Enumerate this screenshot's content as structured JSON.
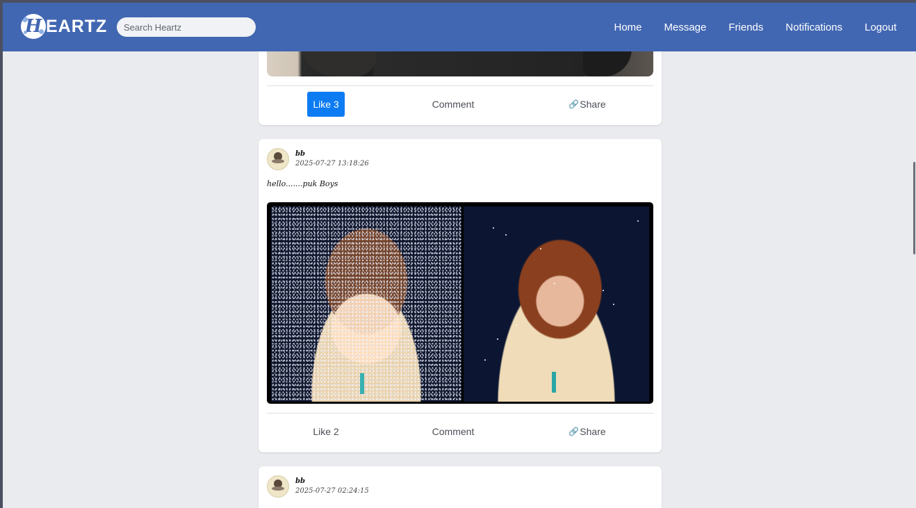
{
  "navbar": {
    "logo_letter": "H",
    "logo_text": "EARTZ",
    "search_placeholder": "Search Heartz",
    "links": [
      "Home",
      "Message",
      "Friends",
      "Notifications",
      "Logout"
    ]
  },
  "colors": {
    "navbar": "#4267b2",
    "background": "#e9ebee",
    "like_active": "#0d7cf2"
  },
  "posts": [
    {
      "actions": {
        "like": "Like 3",
        "like_active": true,
        "comment": "Comment",
        "share": "Share"
      }
    },
    {
      "author": "bb",
      "timestamp": "2025-07-27 13:18:26",
      "text": "hello.......puk Boys",
      "actions": {
        "like": "Like 2",
        "like_active": false,
        "comment": "Comment",
        "share": "Share"
      }
    },
    {
      "author": "bb",
      "timestamp": "2025-07-27 02:24:15"
    }
  ],
  "icons": {
    "share": "link-icon",
    "avatar": "avatar-image"
  }
}
